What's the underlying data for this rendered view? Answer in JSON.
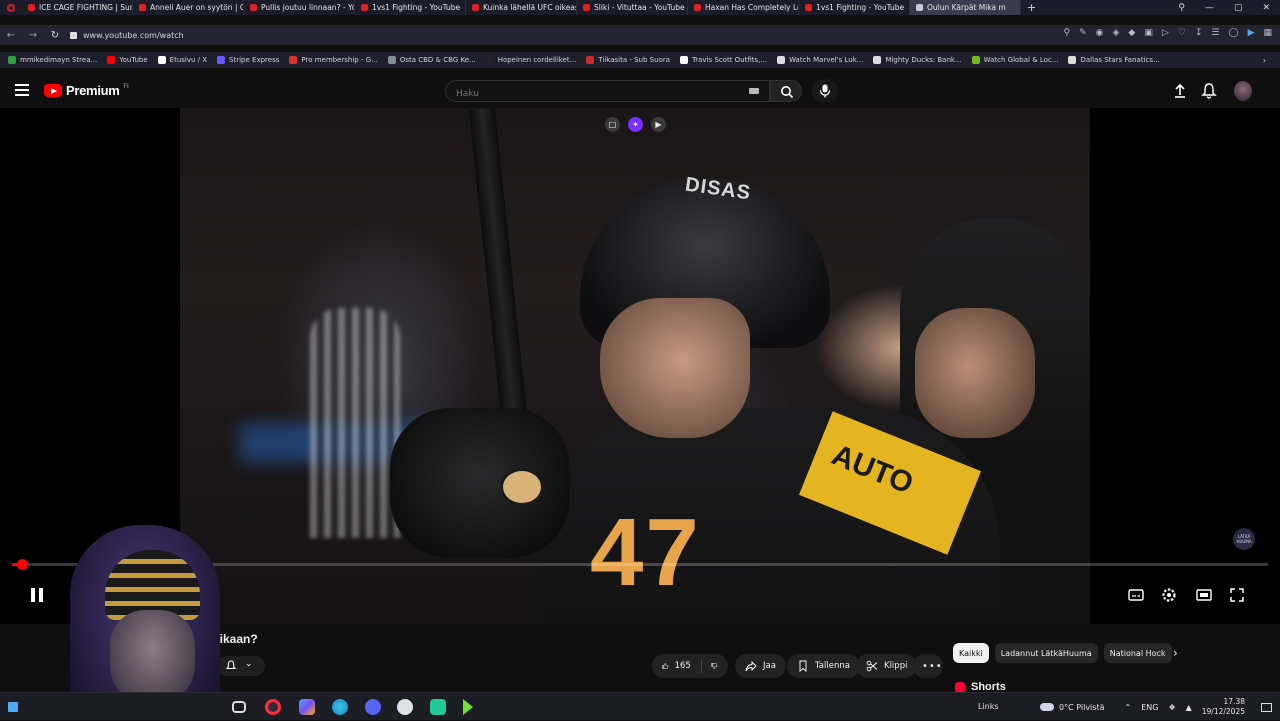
{
  "browser": {
    "tabs": [
      {
        "label": "ICE CAGE FIGHTING | Sun",
        "active": false
      },
      {
        "label": "Anneli Auer on syytön | O",
        "active": false
      },
      {
        "label": "Pullis joutuu linnaan? - Yo",
        "active": false
      },
      {
        "label": "1vs1 Fighting - YouTube",
        "active": false
      },
      {
        "label": "Kuinka lähellä UFC oikeas",
        "active": false
      },
      {
        "label": "Sliki - Vituttaa - YouTube",
        "active": false
      },
      {
        "label": "Haxan Has Completely Lo",
        "active": false
      },
      {
        "label": "1vs1 Fighting - YouTube",
        "active": false
      },
      {
        "label": "Oulun Kärpät Mika m",
        "active": true
      }
    ],
    "url": "www.youtube.com/watch",
    "bookmarks": [
      {
        "label": "mmikedimayn Strea...",
        "color": "#2f9e44"
      },
      {
        "label": "YouTube",
        "color": "#ff0000"
      },
      {
        "label": "Etusivu / X",
        "color": "#ffffff"
      },
      {
        "label": "Stripe Express",
        "color": "#635bff"
      },
      {
        "label": "Pro membership - G...",
        "color": "#e03131"
      },
      {
        "label": "Osta CBD & CBG Ke...",
        "color": "#868e96"
      },
      {
        "label": "Hopeinen cordelliket...",
        "color": "#222222"
      },
      {
        "label": "Tiikasita - Sub Suora",
        "color": "#c92a2a"
      },
      {
        "label": "Travis Scott Outfits,...",
        "color": "#ffffff"
      },
      {
        "label": "Watch Marvel's Luk...",
        "color": "#dddddd"
      },
      {
        "label": "Mighty Ducks: Bank...",
        "color": "#dddddd"
      },
      {
        "label": "Watch Global & Loc...",
        "color": "#74b816"
      },
      {
        "label": "Dallas Stars Fanatics...",
        "color": "#dddddd"
      }
    ]
  },
  "youtube": {
    "brand": "Premium",
    "country": "FI",
    "search_placeholder": "Haku",
    "video": {
      "progress_fraction": 0.008,
      "channel_badge": "LÄTKÄ HUUMA"
    },
    "title_fragment": "vikaan?",
    "actions": {
      "likes": "165",
      "share": "Jaa",
      "save": "Tallenna",
      "clip": "Klippi"
    },
    "chips": [
      {
        "label": "Kaikki",
        "active": true
      },
      {
        "label": "Ladannut LätkäHuuma",
        "active": false
      },
      {
        "label": "National Hock",
        "active": false
      }
    ],
    "shorts_label": "Shorts"
  },
  "taskbar": {
    "links_label": "Links",
    "weather": "0°C  Pilvistä",
    "language": "ENG",
    "time": "17.38",
    "date": "19/12/2025"
  }
}
